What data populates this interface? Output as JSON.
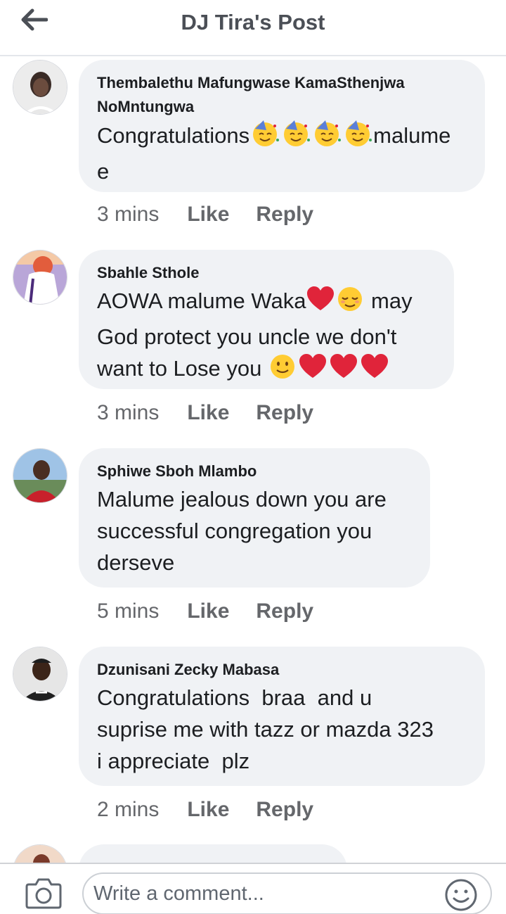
{
  "header": {
    "title": "DJ Tira's Post",
    "back_icon": "back-arrow-icon"
  },
  "comments": [
    {
      "author": "Thembalethu Mafungwase KamaSthenjwa NoMntungwa",
      "text_before": "Congratulations",
      "emojis_mid": [
        "partying-face",
        "partying-face",
        "partying-face",
        "partying-face"
      ],
      "text_after": "malume e",
      "time": "3 mins",
      "like_label": "Like",
      "reply_label": "Reply"
    },
    {
      "author": "Sbahle Sthole",
      "line1": "AOWA malume Waka",
      "line1_after": " may",
      "line2": "God protect you uncle we don't",
      "line3": "want to Lose you ",
      "emojis": [
        "red-heart",
        "relieved-face",
        "slightly-smiling-face",
        "red-heart",
        "red-heart",
        "red-heart"
      ],
      "time": "3 mins",
      "like_label": "Like",
      "reply_label": "Reply"
    },
    {
      "author": "Sphiwe Sboh Mlambo",
      "line1": "Malume jealous down you are",
      "line2": "successful congregation you",
      "line3": "derseve",
      "time": "5 mins",
      "like_label": "Like",
      "reply_label": "Reply"
    },
    {
      "author": "Dzunisani Zecky Mabasa",
      "line1": "Congratulations  braa  and u",
      "line2": "suprise me with tazz or mazda 323",
      "line3": "i appreciate  plz",
      "time": "2 mins",
      "like_label": "Like",
      "reply_label": "Reply"
    }
  ],
  "footer": {
    "placeholder": "Write a comment...",
    "camera_icon": "camera-icon",
    "emoji_icon": "smiley-icon"
  },
  "colors": {
    "bubble": "#f0f2f5",
    "meta_text": "#65676b",
    "title": "#4b4f56",
    "heart": "#e0243a",
    "emoji_yellow": "#ffcc33"
  }
}
